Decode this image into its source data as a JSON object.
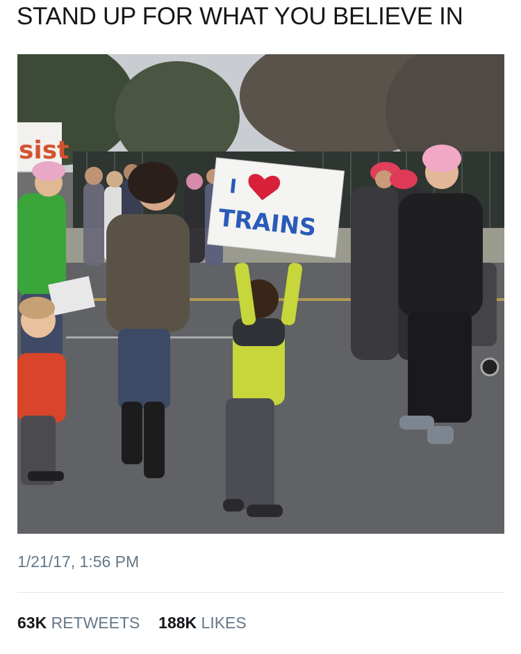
{
  "tweet": {
    "text": "STAND UP FOR WHAT YOU BELIEVE IN",
    "timestamp": "1/21/17, 1:56 PM"
  },
  "stats": {
    "retweets_count": "63K",
    "retweets_label": "RETWEETS",
    "likes_count": "188K",
    "likes_label": "LIKES"
  },
  "photo": {
    "sign": {
      "line1": "I",
      "line2": "TRAINS"
    },
    "background_sign": "sist"
  },
  "colors": {
    "text": "#14171a",
    "secondary": "#657786",
    "divider": "#e1e8ed",
    "sign_ink": "#2a5bb8",
    "heart": "#d8203a"
  }
}
